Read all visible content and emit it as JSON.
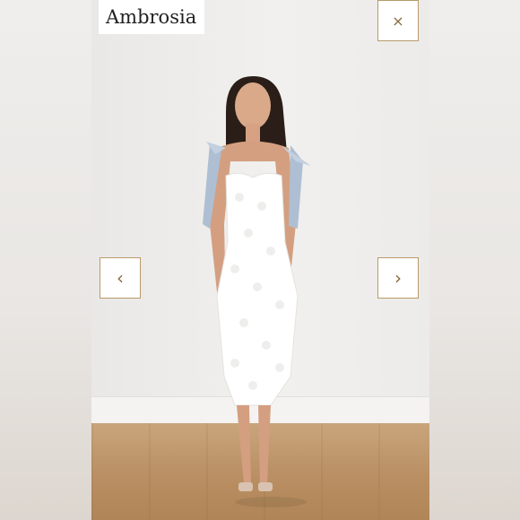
{
  "gallery": {
    "title": "Ambrosia",
    "close_icon": "×",
    "prev_icon": "‹",
    "next_icon": "›"
  },
  "colors": {
    "accent_border": "#b89a6a",
    "icon": "#8a6a3e",
    "title_text": "#222222"
  }
}
